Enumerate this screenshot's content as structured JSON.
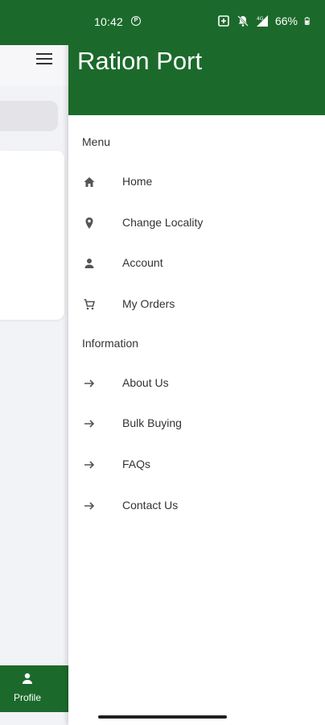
{
  "status_bar": {
    "time": "10:42",
    "battery": "66%"
  },
  "background_app": {
    "bottom_nav": {
      "profile_label": "Profile"
    }
  },
  "drawer": {
    "title": "Ration Port",
    "sections": {
      "menu_label": "Menu",
      "information_label": "Information"
    },
    "menu_items": [
      {
        "label": "Home",
        "icon": "home-icon"
      },
      {
        "label": "Change Locality",
        "icon": "location-pin-icon"
      },
      {
        "label": "Account",
        "icon": "person-icon"
      },
      {
        "label": "My Orders",
        "icon": "cart-icon"
      }
    ],
    "info_items": [
      {
        "label": "About Us",
        "icon": "arrow-right-icon"
      },
      {
        "label": "Bulk Buying",
        "icon": "arrow-right-icon"
      },
      {
        "label": "FAQs",
        "icon": "arrow-right-icon"
      },
      {
        "label": "Contact Us",
        "icon": "arrow-right-icon"
      }
    ]
  },
  "colors": {
    "brand_green": "#1b6a2b",
    "drawer_bg": "#ffffff",
    "text": "#333333"
  }
}
